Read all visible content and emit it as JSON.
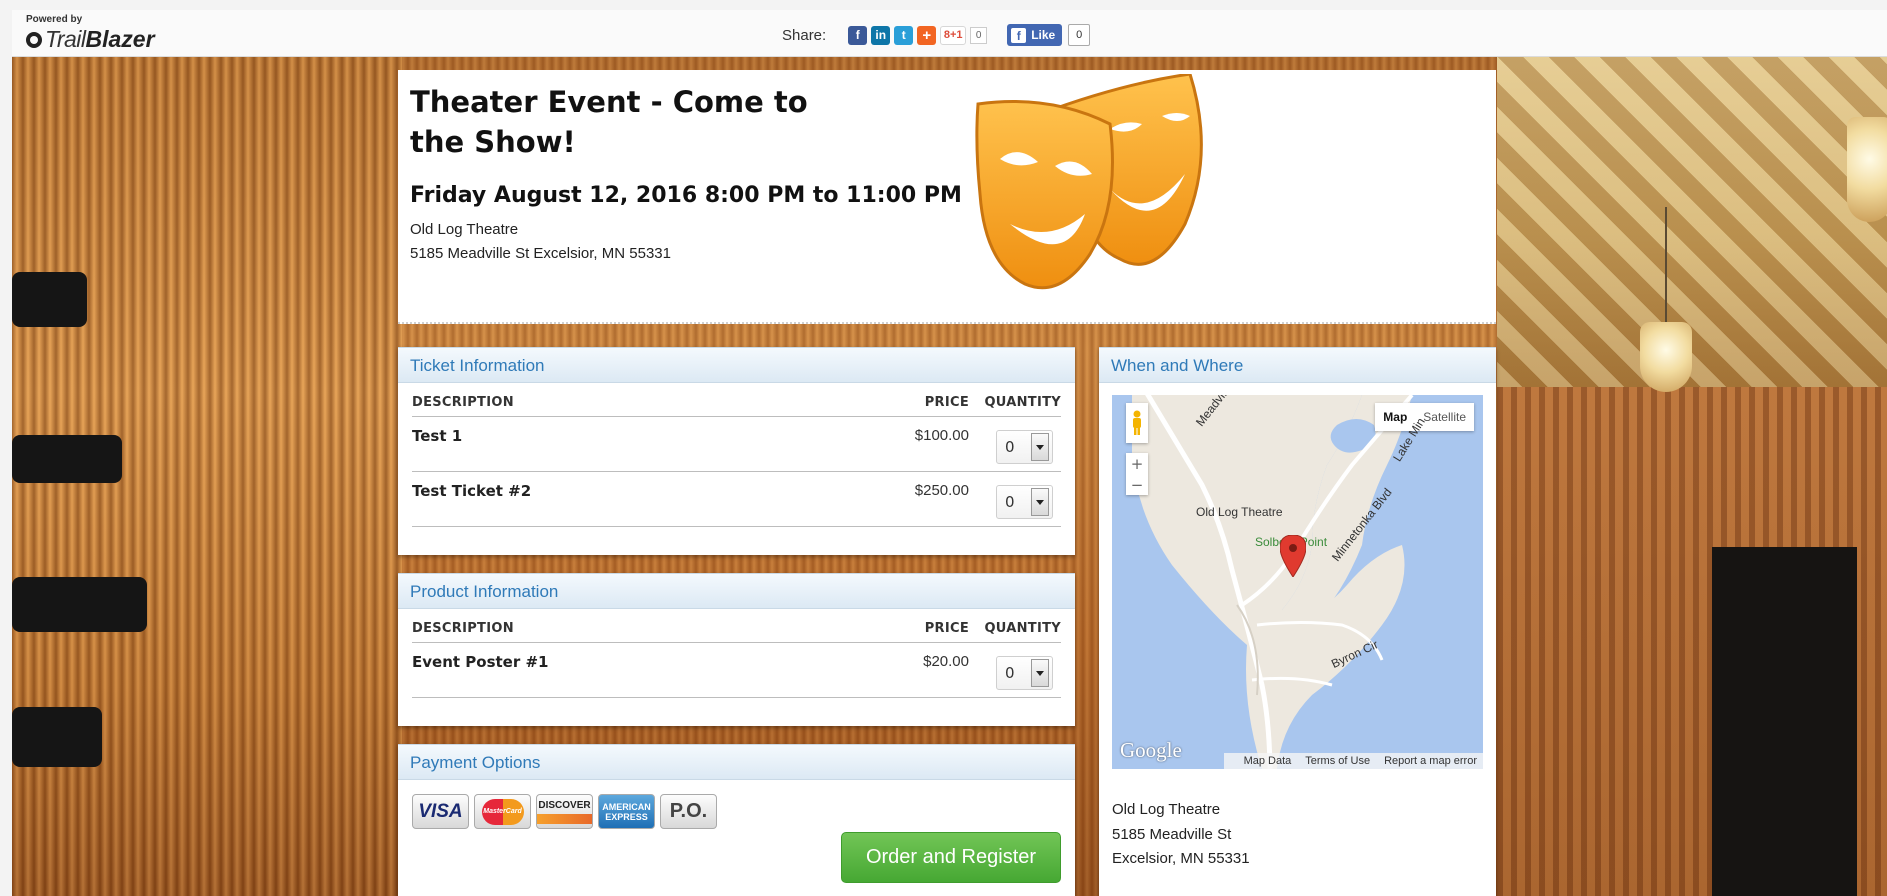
{
  "topbar": {
    "powered_by": "Powered by",
    "brand_trail": "Trail",
    "brand_blazer": "Blazer",
    "share_label": "Share:",
    "share_icons": [
      "facebook-icon",
      "linkedin-icon",
      "twitter-icon",
      "addthis-icon",
      "google-plus-icon"
    ],
    "gplus_label": "8+1",
    "gplus_count": "0",
    "fb_like_label": "Like",
    "fb_like_count": "0"
  },
  "event": {
    "title": "Theater Event - Come to the Show!",
    "date": "Friday August 12, 2016 8:00 PM to 11:00 PM",
    "venue": "Old Log Theatre",
    "address": "5185 Meadville St Excelsior, MN 55331"
  },
  "tickets": {
    "heading": "Ticket Information",
    "columns": [
      "DESCRIPTION",
      "PRICE",
      "QUANTITY"
    ],
    "rows": [
      {
        "description": "Test 1",
        "price": "$100.00",
        "quantity": "0"
      },
      {
        "description": "Test Ticket #2",
        "price": "$250.00",
        "quantity": "0"
      }
    ]
  },
  "products": {
    "heading": "Product Information",
    "columns": [
      "DESCRIPTION",
      "PRICE",
      "QUANTITY"
    ],
    "rows": [
      {
        "description": "Event Poster #1",
        "price": "$20.00",
        "quantity": "0"
      }
    ]
  },
  "payment": {
    "heading": "Payment Options",
    "cards": {
      "visa": "VISA",
      "mastercard": "MasterCard",
      "discover": "DISCOVER",
      "amex_line1": "AMERICAN",
      "amex_line2": "EXPRESS",
      "po": "P.O."
    },
    "order_button": "Order and Register"
  },
  "where": {
    "heading": "When and Where",
    "map": {
      "btn_map": "Map",
      "btn_satellite": "Satellite",
      "zoom_in": "+",
      "zoom_out": "−",
      "label_meadville": "Meadville St",
      "label_lakemin": "Lake Min",
      "label_theatre": "Old Log Theatre",
      "label_solberg": "Solberg Point",
      "label_minnetonka": "Minnetonka Blvd",
      "label_byron": "Byron Cir",
      "google": "Google",
      "footer": [
        "Map Data",
        "Terms of Use",
        "Report a map error"
      ]
    },
    "venue": "Old Log Theatre",
    "street": "5185 Meadville St",
    "city": "Excelsior, MN 55331"
  },
  "colors": {
    "accent_blue": "#2f7ab8",
    "order_green": "#46a833",
    "mask_orange": "#f5a120"
  }
}
